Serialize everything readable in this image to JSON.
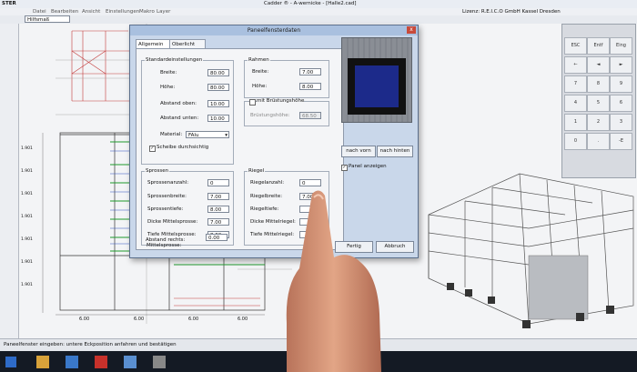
{
  "window": {
    "app_label": "STER",
    "title": "Cadder ® - A-wernicke - [Halle2.cad]",
    "license": "Lizenz: R.E.I.C.O GmbH Kassel Dresden",
    "menu": [
      "Datei",
      "Bearbeiten",
      "Ansicht",
      "Einstellungen",
      "Makro",
      "Layer"
    ],
    "layer_select": "Hilfsmaß"
  },
  "dialog": {
    "title": "Paneelfensterdaten",
    "close_label": "x",
    "tabs": [
      "Allgemein",
      "Oberlicht"
    ],
    "standard": {
      "title": "Standardeinstellungen",
      "breite_label": "Breite:",
      "breite_value": "80.00",
      "hoehe_label": "Höhe:",
      "hoehe_value": "80.00",
      "abstand_oben_label": "Abstand oben:",
      "abstand_oben_value": "10.00",
      "abstand_unten_label": "Abstand unten:",
      "abstand_unten_value": "10.00",
      "material_label": "Material:",
      "material_value": "FAlu",
      "scheibe_label": "Scheibe durchsichtig"
    },
    "rahmen": {
      "title": "Rahmen",
      "breite_label": "Breite:",
      "breite_value": "7.00",
      "hoehe_label": "Höhe:",
      "hoehe_value": "8.00",
      "bruestung_label": "mit Brüstungshöhe",
      "bruestung_hoehe_label": "Brüstungshöhe:",
      "bruestung_hoehe_value": "68.50"
    },
    "sprossen": {
      "title": "Sprossen",
      "anzahl_label": "Sprossenanzahl:",
      "anzahl_value": "0",
      "breite_label": "Sprossenbreite:",
      "breite_value": "7.00",
      "tiefe_label": "Sprossentiefe:",
      "tiefe_value": "8.00",
      "dicke_label": "Dicke Mittelsprosse:",
      "dicke_value": "7.00",
      "tiefe_mittel_label": "Tiefe Mittelsprosse:",
      "tiefe_mittel_value": "8.00",
      "mittel_abstand_label_1": "Mittelsprosse:",
      "mittel_abstand_label_2": "Abstand rechts:",
      "mittel_abstand_value": "0.00"
    },
    "riegel": {
      "title": "Riegel",
      "anzahl_label": "Riegelanzahl:",
      "anzahl_value": "0",
      "breite_label": "Riegelbreite:",
      "breite_value": "7.00",
      "tiefe_label": "Riegeltiefe:",
      "dicke_label": "Dicke Mittelriegel:",
      "tiefe_mittel_label": "Tiefe Mittelriegel:"
    },
    "nach_vorn": "nach vorn",
    "nach_hinten": "nach hinten",
    "panel_anzeigen": "Panel anzeigen",
    "fertig": "Fertig",
    "abbruch": "Abbruch"
  },
  "keypad": [
    "ESC",
    "Entf",
    "Eing",
    "←",
    "◄",
    "►",
    "7",
    "8",
    "9",
    "4",
    "5",
    "6",
    "1",
    "2",
    "3",
    "0",
    ".",
    "-E"
  ],
  "status": {
    "text": "Paneelfenster eingeben: untere Eckposition anfahren und bestätigen"
  },
  "drawing": {
    "dims_bottom": [
      "6.00",
      "6.00",
      "6.00",
      "6.00"
    ],
    "dims_left": [
      "1.901",
      "1.901",
      "1.901",
      "1.901",
      "1.901",
      "1.901",
      "1.901"
    ]
  },
  "colors": {
    "preview_glass": "#1c2a8a",
    "drawing_green": "#1f9a2c",
    "drawing_red": "#c43a3a",
    "drawing_blue": "#3050c0",
    "taskbar": "#141a24"
  }
}
